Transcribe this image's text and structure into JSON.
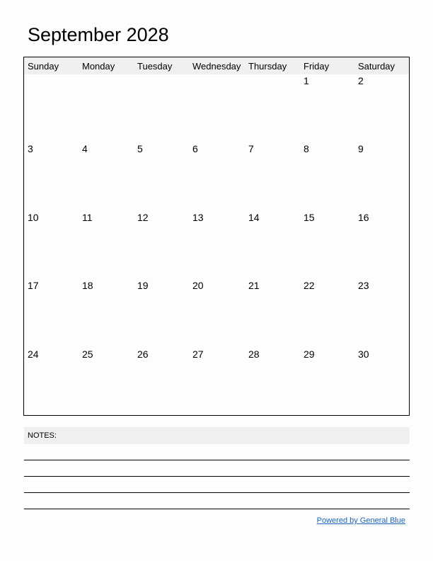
{
  "title": "September 2028",
  "weekdays": [
    "Sunday",
    "Monday",
    "Tuesday",
    "Wednesday",
    "Thursday",
    "Friday",
    "Saturday"
  ],
  "weeks": [
    [
      "",
      "",
      "",
      "",
      "",
      "1",
      "2"
    ],
    [
      "3",
      "4",
      "5",
      "6",
      "7",
      "8",
      "9"
    ],
    [
      "10",
      "11",
      "12",
      "13",
      "14",
      "15",
      "16"
    ],
    [
      "17",
      "18",
      "19",
      "20",
      "21",
      "22",
      "23"
    ],
    [
      "24",
      "25",
      "26",
      "27",
      "28",
      "29",
      "30"
    ]
  ],
  "notes": {
    "label": "NOTES:"
  },
  "footer": {
    "link": "Powered by General Blue"
  },
  "colors": {
    "header_bg": "#f0f0f0",
    "link": "#1a63b5"
  }
}
